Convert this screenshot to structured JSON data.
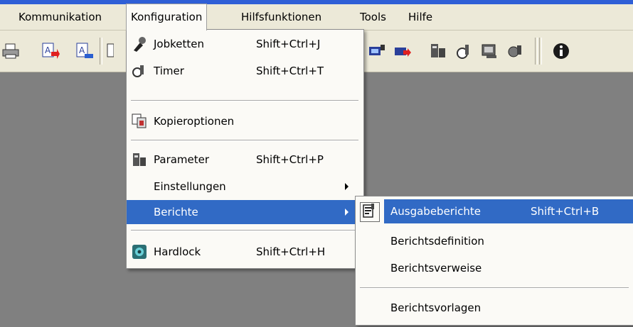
{
  "menubar": {
    "items": [
      "Kommunikation",
      "Konfiguration",
      "Hilfsfunktionen",
      "Tools",
      "Hilfe"
    ]
  },
  "toolbar": {
    "icons": [
      "printer-icon",
      "report-red-arrow-icon",
      "report-blue-arrow-icon",
      "document-icon",
      "transfer-icon",
      "transfer-red-icon",
      "parameter-icon",
      "timer-icon",
      "settings-icon",
      "job-icon",
      "info-icon"
    ]
  },
  "konfiguration_menu": {
    "items": [
      {
        "label": "Jobketten",
        "shortcut": "Shift+Ctrl+J",
        "icon": "jobketten-icon"
      },
      {
        "label": "Timer",
        "shortcut": "Shift+Ctrl+T",
        "icon": "timer-icon"
      },
      {
        "label": "Kopieroptionen",
        "shortcut": "",
        "icon": "kopieroptionen-icon"
      },
      {
        "label": "Parameter",
        "shortcut": "Shift+Ctrl+P",
        "icon": "parameter-icon"
      },
      {
        "label": "Einstellungen",
        "shortcut": "",
        "icon": ""
      },
      {
        "label": "Berichte",
        "shortcut": "",
        "icon": ""
      },
      {
        "label": "Hardlock",
        "shortcut": "Shift+Ctrl+H",
        "icon": "hardlock-icon"
      }
    ]
  },
  "berichte_submenu": {
    "items": [
      {
        "label": "Ausgabeberichte",
        "shortcut": "Shift+Ctrl+B",
        "icon": "report-icon"
      },
      {
        "label": "Berichtsdefinition",
        "shortcut": ""
      },
      {
        "label": "Berichtsverweise",
        "shortcut": ""
      },
      {
        "label": "Berichtsvorlagen",
        "shortcut": ""
      }
    ]
  },
  "colors": {
    "highlight": "#316ac5",
    "menubar": "#ece9d8",
    "workspace": "#808080",
    "menu_bg": "#fbfaf6"
  }
}
